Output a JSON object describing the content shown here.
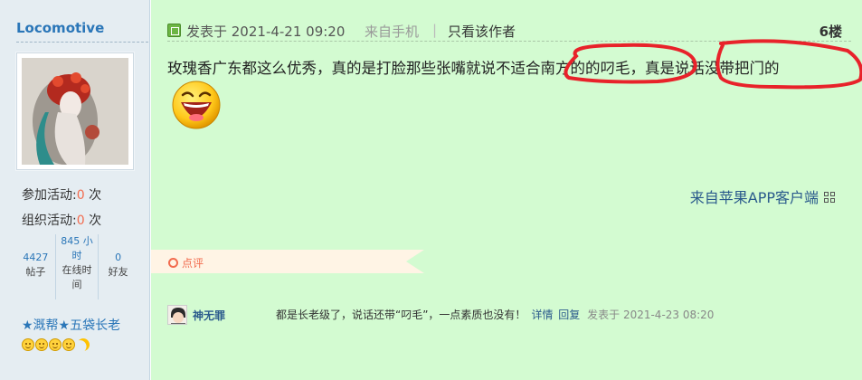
{
  "profile": {
    "username": "Locomotive",
    "stats": [
      {
        "label": "参加活动:",
        "value": "0",
        "unit": " 次"
      },
      {
        "label": "组织活动:",
        "value": "0",
        "unit": " 次"
      }
    ],
    "mini": [
      {
        "value": "4427",
        "label": "帖子"
      },
      {
        "value": "845 小时",
        "label": "在线时间"
      },
      {
        "value": "0",
        "label": "好友"
      }
    ],
    "group": "★溉帮★五袋长老"
  },
  "post": {
    "posted_at": "发表于 2021-4-21 09:20",
    "device": "来自手机",
    "pipe": "|",
    "only_author": "只看该作者",
    "floor": "6楼",
    "text": "玫瑰香广东都这么优秀，真的是打脸那些张嘴就说不适合南方的的叼毛，真是说话没带把门的",
    "source": "来自苹果APP客户端"
  },
  "comment_bar": {
    "label": "点评"
  },
  "comment": {
    "user": "神无罪",
    "text": "都是长老级了，说话还带“叼毛”，一点素质也没有！",
    "detail": "详情",
    "reply": "回复",
    "time": "发表于 2021-4-23 08:20"
  },
  "colors": {
    "post_bg": "#d3fbd1",
    "sidebar_bg": "#e5edf2",
    "link_blue": "#2a76b8",
    "accent_orange": "#f26c4f",
    "annotation_red": "#e8222a"
  }
}
